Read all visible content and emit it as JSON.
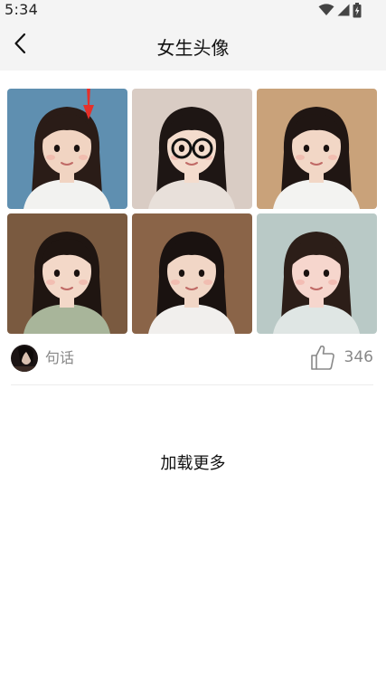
{
  "status_bar": {
    "time": "5:34",
    "icons": [
      "wifi-icon",
      "signal-icon",
      "battery-charging-icon"
    ]
  },
  "app_bar": {
    "back_icon": "chevron-left-icon",
    "title": "女生头像"
  },
  "photos": [
    {
      "name": "photo-1",
      "bg": "#5f8fb0",
      "skin": "#f1d4c2",
      "hair": "#2a1c17",
      "shirt": "#f2f2f0",
      "annotation": "red-arrow"
    },
    {
      "name": "photo-2",
      "bg": "#d9ccc4",
      "skin": "#f4dccd",
      "hair": "#1e1614",
      "shirt": "#e8e0da",
      "accessory": "glasses"
    },
    {
      "name": "photo-3",
      "bg": "#c9a27a",
      "skin": "#f2d7c6",
      "hair": "#201613",
      "shirt": "#f3f3f1"
    },
    {
      "name": "photo-4",
      "bg": "#7a5a40",
      "skin": "#f3d8c8",
      "hair": "#1f1511",
      "shirt": "#a8b59a"
    },
    {
      "name": "photo-5",
      "bg": "#8a6448",
      "skin": "#f1d6c6",
      "hair": "#1a1210",
      "shirt": "#f1efed"
    },
    {
      "name": "photo-6",
      "bg": "#b9c9c6",
      "skin": "#f6d6cd",
      "hair": "#2c1e18",
      "shirt": "#dfe6e4"
    }
  ],
  "post": {
    "author_name": "句话",
    "like_count": "346",
    "like_icon": "thumbs-up-icon"
  },
  "load_more_label": "加载更多",
  "colors": {
    "header_bg": "#f4f4f4",
    "arrow_red": "#e5302a",
    "muted_text": "#888888"
  }
}
